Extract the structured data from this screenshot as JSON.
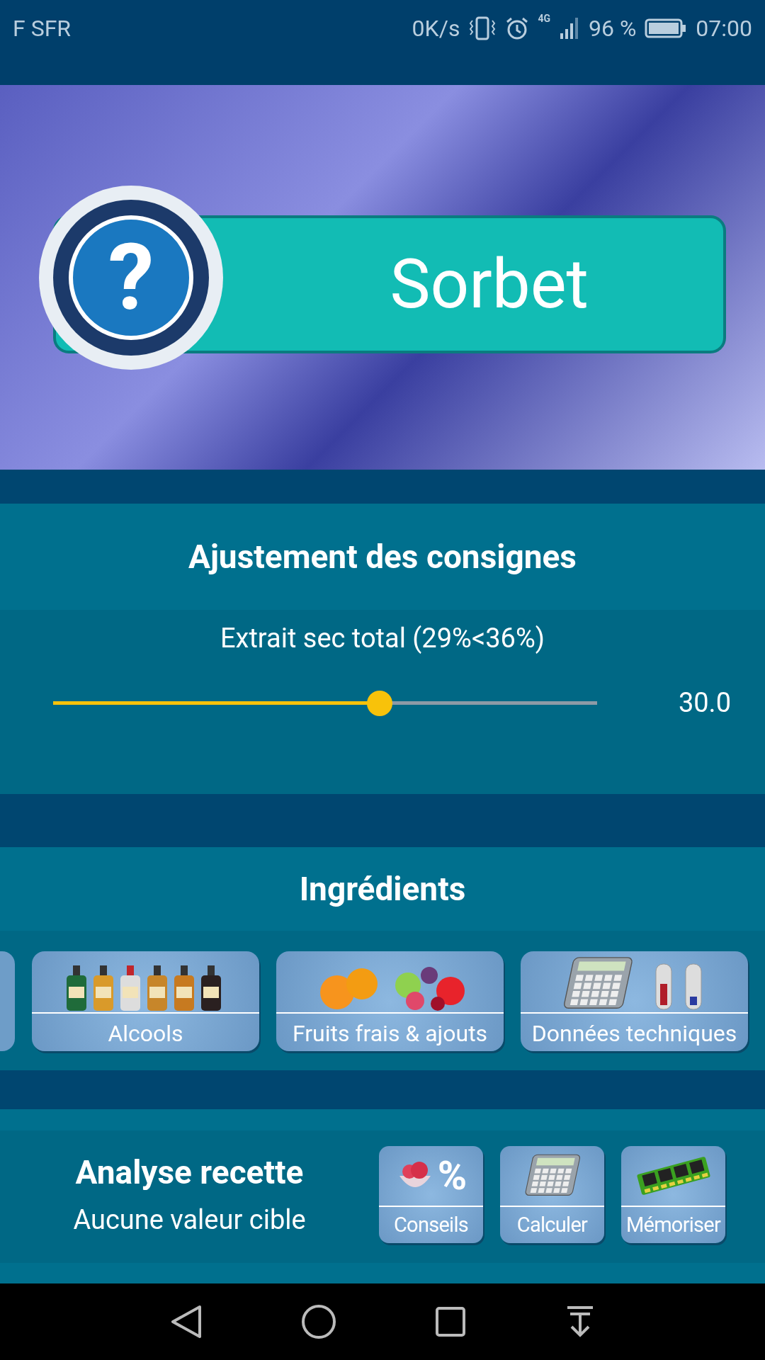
{
  "status_bar": {
    "carrier": "F SFR",
    "speed": "0K/s",
    "network": "4G",
    "battery": "96 %",
    "time": "07:00"
  },
  "banner": {
    "symbol": "?",
    "title": "Sorbet"
  },
  "settings": {
    "title": "Ajustement des consignes",
    "slider": {
      "label": "Extrait sec total (29%<36%)",
      "level": 0.6,
      "reading": "30.0"
    }
  },
  "ingredients": {
    "title": "Ingrédients",
    "categories": [
      {
        "kind": "alcohol",
        "label": "Alcools"
      },
      {
        "kind": "fruit",
        "label": "Fruits frais & ajouts"
      },
      {
        "kind": "technical",
        "label": "Données techniques"
      }
    ]
  },
  "analysis": {
    "title": "Analyse recette",
    "subtitle": "Aucune valeur cible",
    "buttons": [
      {
        "kind": "tips",
        "label": "Conseils",
        "symbol": "%"
      },
      {
        "kind": "calculate",
        "label": "Calculer"
      },
      {
        "kind": "memorize",
        "label": "Mémoriser"
      }
    ]
  }
}
